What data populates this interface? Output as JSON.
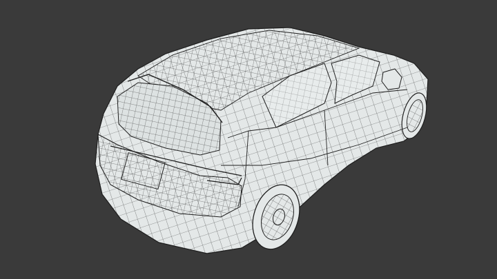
{
  "scene": {
    "background_color": "#3a3a3a",
    "mesh_fill_color": "#e4e8e8",
    "mesh_line_color": "#2a2a2a",
    "subject": "car-wireframe-mesh"
  }
}
